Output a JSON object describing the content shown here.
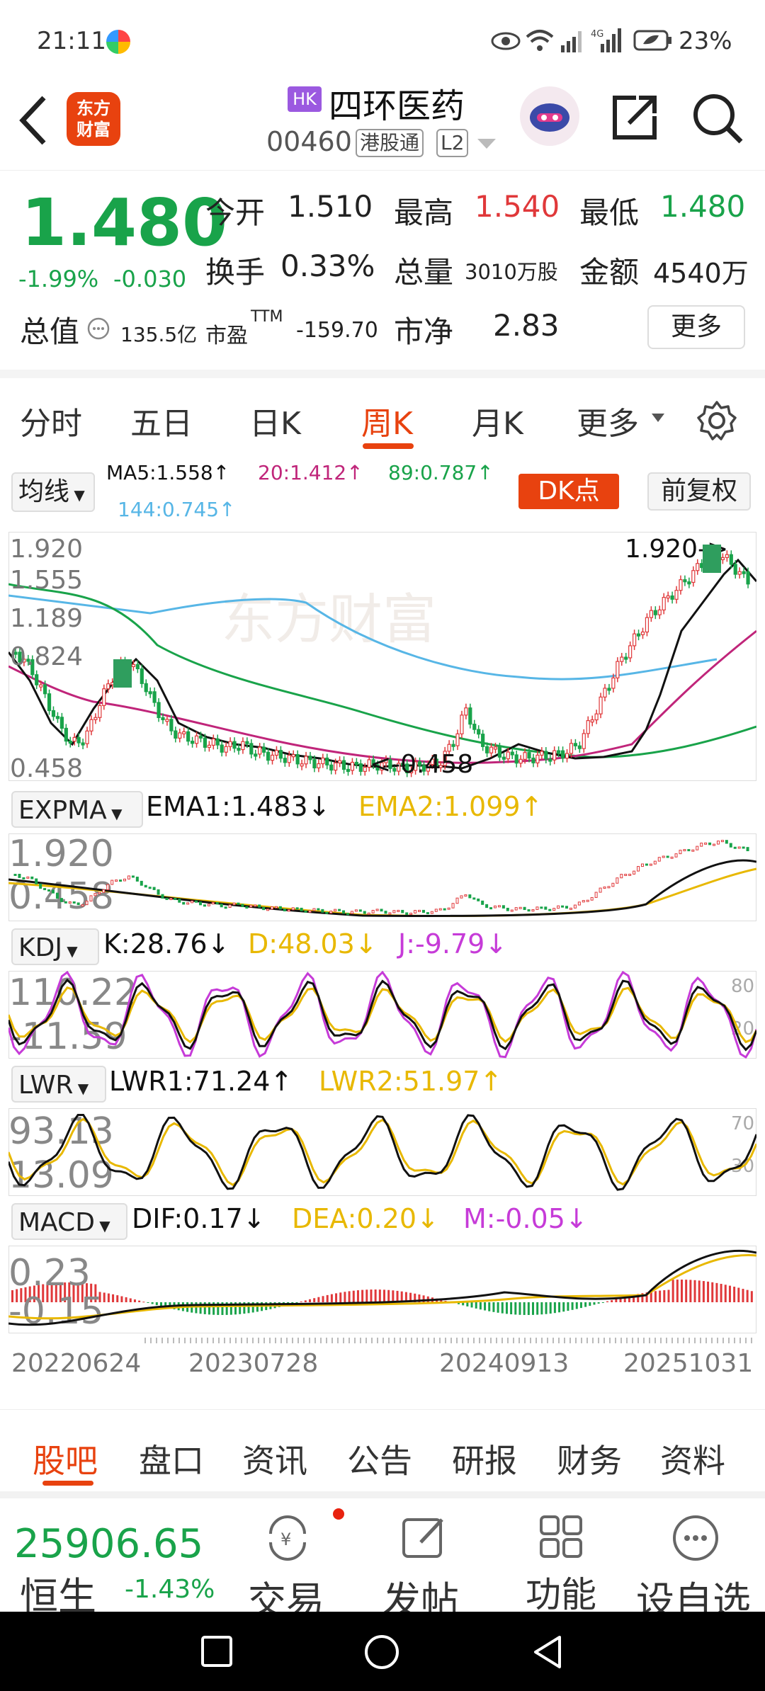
{
  "status": {
    "time": "21:11",
    "battery": "23%",
    "net": "4G"
  },
  "header": {
    "back": "<",
    "logo": "东方\n财富",
    "hk_badge": "HK",
    "stock_name": "四环医药",
    "code": "00460",
    "connect": "港股通",
    "level": "L2"
  },
  "quote": {
    "price": "1.480",
    "change_pct": "-1.99%",
    "change": "-0.030",
    "open_label": "今开",
    "open": "1.510",
    "high_label": "最高",
    "high": "1.540",
    "low_label": "最低",
    "low": "1.480",
    "turnover_label": "换手",
    "turnover": "0.33%",
    "volume_label": "总量",
    "volume": "3010万股",
    "amount_label": "金额",
    "amount": "4540万",
    "mktcap_label": "总值",
    "mktcap": "135.5亿",
    "pe_label": "市盈",
    "pe_sup": "TTM",
    "pe": "-159.70",
    "pb_label": "市净",
    "pb": "2.83",
    "more": "更多"
  },
  "tabs": [
    "分时",
    "五日",
    "日K",
    "周K",
    "月K",
    "更多"
  ],
  "active_tab": "周K",
  "ma": {
    "selector": "均线",
    "ma5": "MA5:1.558↑",
    "ma20": "20:1.412↑",
    "ma89": "89:0.787↑",
    "ma144": "144:0.745↑",
    "dk_button": "DK点",
    "adjust": "前复权"
  },
  "main_chart": {
    "y_labels": [
      "1.920",
      "1.555",
      "1.189",
      "0.824",
      "0.458"
    ],
    "high_note": "1.920->",
    "low_note": "<-0.458",
    "watermark": "东方财富"
  },
  "expma": {
    "name": "EXPMA",
    "ema1": "EMA1:1.483↓",
    "ema2": "EMA2:1.099↑",
    "y_top": "1.920",
    "y_bot": "0.458"
  },
  "kdj": {
    "name": "KDJ",
    "k": "K:28.76↓",
    "d": "D:48.03↓",
    "j": "J:-9.79↓",
    "y_top": "110.22",
    "y_bot": "-11.59",
    "r_top": "80",
    "r_bot": "20"
  },
  "lwr": {
    "name": "LWR",
    "lwr1": "LWR1:71.24↑",
    "lwr2": "LWR2:51.97↑",
    "y_top": "93.13",
    "y_bot": "13.09",
    "r_top": "70",
    "r_bot": "30"
  },
  "macd": {
    "name": "MACD",
    "dif": "DIF:0.17↓",
    "dea": "DEA:0.20↓",
    "m": "M:-0.05↓",
    "y_top": "0.23",
    "y_bot": "-0.15"
  },
  "x_dates": [
    "20220624",
    "20230728",
    "20240913",
    "20251031"
  ],
  "bottom_tabs": [
    "股吧",
    "盘口",
    "资讯",
    "公告",
    "研报",
    "财务",
    "资料"
  ],
  "active_bottom_tab": "股吧",
  "dock": {
    "index_value": "25906.65",
    "index_name": "恒生",
    "index_change": "-1.43%",
    "trade": "交易",
    "post": "发帖",
    "func": "功能",
    "watch": "设自选"
  },
  "colors": {
    "up": "#e0383a",
    "down": "#19a34a",
    "accent": "#e8420f",
    "ema2": "#e8b800",
    "purple": "#c63bd8",
    "cyan": "#57b6e6"
  }
}
